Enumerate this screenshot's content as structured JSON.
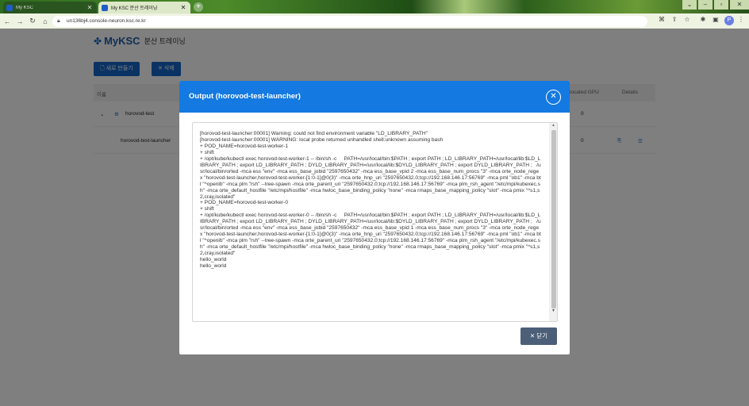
{
  "browser": {
    "tabs": [
      {
        "title": "My KSC"
      },
      {
        "title": "My KSC 분산 트레이닝"
      }
    ],
    "url": "un136bj4.console-neuron.ksc.re.kr",
    "profile_initial": "P"
  },
  "page": {
    "logo": "MyKSC",
    "title": "분산 트레이닝",
    "buttons": {
      "create": "새로 만들기",
      "delete": "삭제"
    },
    "table": {
      "headers": {
        "name": "이름",
        "gpu": "located GPU",
        "details": "Details"
      },
      "rows": [
        {
          "name": "horovod-test",
          "gpu": "0"
        },
        {
          "name": "horovod-test-launcher",
          "gpu": "0"
        }
      ]
    }
  },
  "modal": {
    "title": "Output (horovod-test-launcher)",
    "close_label": "닫기",
    "log": "[horovod-test-launcher:00001] Warning: could not find environment variable \"LD_LIBRARY_PATH\"\n[horovod-test-launcher:00001] WARNING: local probe returned unhandled shell:unknown assuming bash\n+ POD_NAME=horovod-test-worker-1\n+ shift\n+ /opt/kube/kubectl exec horovod-test-worker-1 -- /bin/sh -c     PATH=/usr/local/bin:$PATH ; export PATH ; LD_LIBRARY_PATH=/usr/local/lib:$LD_LIBRARY_PATH ; export LD_LIBRARY_PATH ; DYLD_LIBRARY_PATH=/usr/local/lib:$DYLD_LIBRARY_PATH ; export DYLD_LIBRARY_PATH ;   /usr/local/bin/orted -mca ess \"env\" -mca ess_base_jobid \"2597650432\" -mca ess_base_vpid 2 -mca ess_base_num_procs \"3\" -mca orte_node_regex \"horovod-test-launcher,horovod-test-worker-[1:0-1]@0(3)\" -mca orte_hnp_uri \"2597650432.0;tcp://192.168.146.17:56769\" -mca pml \"ob1\" -mca btl \"^openib\" -mca plm \"rsh\" --tree-spawn -mca orte_parent_uri \"2597650432.0;tcp://192.168.146.17:56769\" -mca plm_rsh_agent \"/etc/mpi/kubexec.sh\" -mca orte_default_hostfile \"/etc/mpi/hostfile\" -mca hwloc_base_binding_policy \"none\" -mca rmaps_base_mapping_policy \"slot\" -mca pmix \"^s1,s2,cray,isolated\"\n+ POD_NAME=horovod-test-worker-0\n+ shift\n+ /opt/kube/kubectl exec horovod-test-worker-0 -- /bin/sh -c     PATH=/usr/local/bin:$PATH ; export PATH ; LD_LIBRARY_PATH=/usr/local/lib:$LD_LIBRARY_PATH ; export LD_LIBRARY_PATH ; DYLD_LIBRARY_PATH=/usr/local/lib:$DYLD_LIBRARY_PATH ; export DYLD_LIBRARY_PATH ;   /usr/local/bin/orted -mca ess \"env\" -mca ess_base_jobid \"2597650432\" -mca ess_base_vpid 1 -mca ess_base_num_procs \"3\" -mca orte_node_regex \"horovod-test-launcher,horovod-test-worker-[1:0-1]@0(3)\" -mca orte_hnp_uri \"2597650432.0;tcp://192.168.146.17:56769\" -mca pml \"ob1\" -mca btl \"^openib\" -mca plm \"rsh\" --tree-spawn -mca orte_parent_uri \"2597650432.0;tcp://192.168.146.17:56769\" -mca plm_rsh_agent \"/etc/mpi/kubexec.sh\" -mca orte_default_hostfile \"/etc/mpi/hostfile\" -mca hwloc_base_binding_policy \"none\" -mca rmaps_base_mapping_policy \"slot\" -mca pmix \"^s1,s2,cray,isolated\"\nhello_world\nhello_world"
  },
  "colors": {
    "accent": "#1479e0",
    "close_button": "#4c5f78"
  }
}
